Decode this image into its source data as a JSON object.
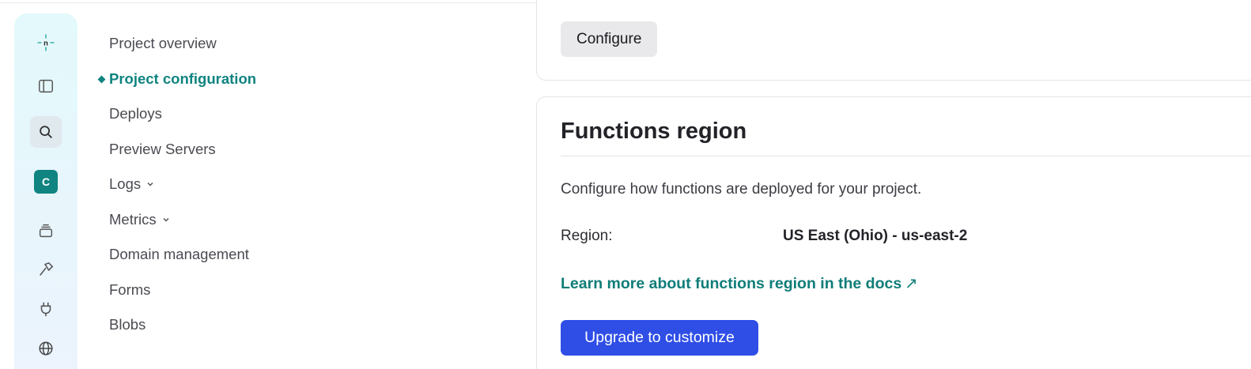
{
  "rail": {
    "logo": "netlify-logo-icon",
    "icons": [
      "sidebar-toggle-icon",
      "search-icon",
      "team-avatar",
      "layers-icon",
      "build-hammer-icon",
      "plug-icon",
      "globe-icon"
    ],
    "avatar_initial": "C",
    "avatar_color": "#0f8480"
  },
  "nav": {
    "items": [
      {
        "label": "Project overview"
      },
      {
        "label": "Project configuration",
        "active": true
      },
      {
        "label": "Deploys"
      },
      {
        "label": "Preview Servers"
      },
      {
        "label": "Logs",
        "expandable": true
      },
      {
        "label": "Metrics",
        "expandable": true
      },
      {
        "label": "Domain management"
      },
      {
        "label": "Forms"
      },
      {
        "label": "Blobs"
      }
    ]
  },
  "top_card": {
    "configure_label": "Configure"
  },
  "functions_region": {
    "title": "Functions region",
    "description": "Configure how functions are deployed for your project.",
    "region_label": "Region:",
    "region_value": "US East (Ohio) - us-east-2",
    "docs_link": "Learn more about functions region in the docs",
    "docs_link_arrow": "↗",
    "upgrade_label": "Upgrade to customize"
  },
  "colors": {
    "accent_teal": "#0f8480",
    "primary_blue": "#2f4ee6"
  }
}
